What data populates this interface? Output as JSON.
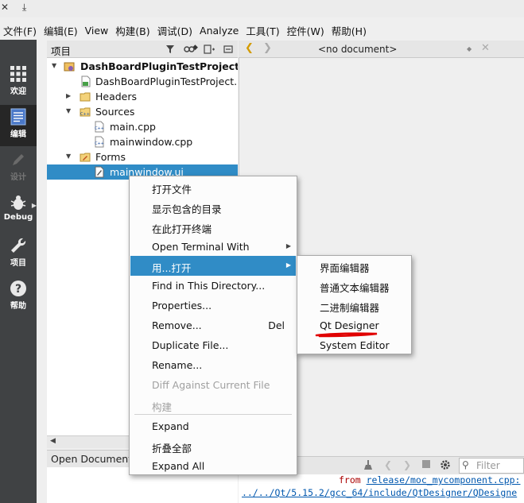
{
  "window": {
    "close_glyph": "✕",
    "pin_glyph": "⤓"
  },
  "menubar": {
    "items": [
      "文件(F)",
      "编辑(E)",
      "View",
      "构建(B)",
      "调试(D)",
      "Analyze",
      "工具(T)",
      "控件(W)",
      "帮助(H)"
    ]
  },
  "modes": [
    {
      "label": "欢迎",
      "icon": "grid-icon",
      "active": false,
      "enabled": true
    },
    {
      "label": "编辑",
      "icon": "edit-document-icon",
      "active": true,
      "enabled": true
    },
    {
      "label": "设计",
      "icon": "pencil-icon",
      "active": false,
      "enabled": false
    },
    {
      "label": "Debug",
      "icon": "bug-icon",
      "active": false,
      "enabled": true
    },
    {
      "label": "项目",
      "icon": "wrench-icon",
      "active": false,
      "enabled": true
    },
    {
      "label": "帮助",
      "icon": "help-icon",
      "active": false,
      "enabled": true
    }
  ],
  "project_pane": {
    "title": "项目",
    "tree": [
      {
        "label": "DashBoardPluginTestProject",
        "icon": "project-icon",
        "bold": true
      },
      {
        "label": "DashBoardPluginTestProject.pro",
        "icon": "pro-file-icon"
      },
      {
        "label": "Headers",
        "icon": "folder-icon"
      },
      {
        "label": "Sources",
        "icon": "folder-cpp-icon"
      },
      {
        "label": "main.cpp",
        "icon": "cpp-file-icon"
      },
      {
        "label": "mainwindow.cpp",
        "icon": "cpp-file-icon"
      },
      {
        "label": "Forms",
        "icon": "folder-forms-icon"
      },
      {
        "label": "mainwindow.ui",
        "icon": "ui-file-icon",
        "selected": true
      }
    ]
  },
  "open_documents": {
    "title": "Open Documents"
  },
  "editor": {
    "document_combo": "<no document>"
  },
  "output": {
    "filter_placeholder": "Filter",
    "lines": [
      {
        "prefix": "from ",
        "link": "release/moc_mycomponent.cpp:"
      },
      {
        "prefix": "",
        "link": "../../Qt/5.15.2/gcc_64/include/QtDesigner/QDesigne"
      }
    ]
  },
  "context_menu": {
    "items": [
      {
        "label": "打开文件"
      },
      {
        "label": "显示包含的目录"
      },
      {
        "label": "在此打开终端"
      },
      {
        "label": "Open Terminal With",
        "submenu": true
      },
      {
        "label": "用...打开",
        "submenu": true,
        "hover": true
      },
      {
        "label": "Find in This Directory..."
      },
      {
        "label": "Properties..."
      },
      {
        "label": "Remove...",
        "shortcut": "Del"
      },
      {
        "label": "Duplicate File..."
      },
      {
        "label": "Rename..."
      },
      {
        "label": "Diff Against Current File",
        "disabled": true
      },
      {
        "label": "构建",
        "disabled": true
      },
      {
        "label": "Expand"
      },
      {
        "label": "折叠全部"
      },
      {
        "label": "Expand All"
      }
    ]
  },
  "open_with_submenu": {
    "items": [
      "界面编辑器",
      "普通文本编辑器",
      "二进制编辑器",
      "Qt Designer",
      "System Editor"
    ],
    "annotation_color": "#e00000"
  }
}
